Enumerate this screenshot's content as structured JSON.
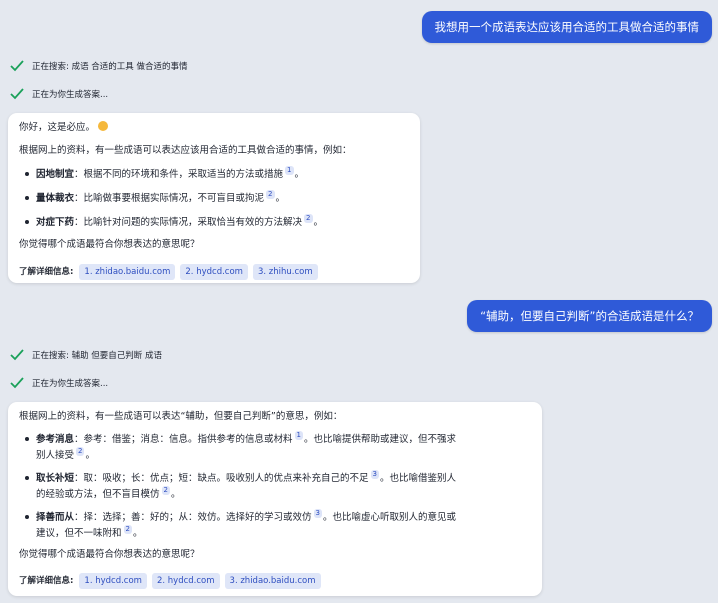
{
  "conversation": {
    "turn1": {
      "user_message": "我想用一个成语表达应该用合适的工具做合适的事情",
      "status_search": "正在搜索: 成语 合适的工具 做合适的事情",
      "status_generating": "正在为你生成答案...",
      "greeting": "你好，这是必应。",
      "intro": "根据网上的资料，有一些成语可以表达应该用合适的工具做合适的事情，例如：",
      "items": [
        {
          "term": "因地制宜",
          "sep": "：",
          "desc": "根据不同的环境和条件，采取适当的方法或措施",
          "cite": "1",
          "end": "。"
        },
        {
          "term": "量体裁衣",
          "sep": "：",
          "desc": "比喻做事要根据实际情况，不可盲目或拘泥",
          "cite": "2",
          "end": "。"
        },
        {
          "term": "对症下药",
          "sep": "：",
          "desc": "比喻针对问题的实际情况，采取恰当有效的方法解决",
          "cite": "2",
          "end": "。"
        }
      ],
      "question": "你觉得哪个成语最符合你想表达的意思呢？",
      "learn_more_label": "了解详细信息:",
      "sources": [
        "1. zhidao.baidu.com",
        "2. hydcd.com",
        "3. zhihu.com"
      ]
    },
    "turn2": {
      "user_message": "“辅助，但要自己判断”的合适成语是什么？",
      "status_search": "正在搜索: 辅助 但要自己判断 成语",
      "status_generating": "正在为你生成答案...",
      "intro": "根据网上的资料，有一些成语可以表达“辅助，但要自己判断”的意思，例如：",
      "items": [
        {
          "term": "参考消息",
          "line1": "：参考：借鉴；消息：信息。指供参考的信息或材料",
          "cite1": "1",
          "line1b": "。也比喻提供帮助或建议，但不强求",
          "line2": "别人接受",
          "cite2": "2",
          "end": "。"
        },
        {
          "term": "取长补短",
          "line1": "：取：吸收；长：优点；短：缺点。吸收别人的优点来补充自己的不足",
          "cite1": "3",
          "line1b": "。也比喻借鉴别人",
          "line2": "的经验或方法，但不盲目模仿",
          "cite2": "2",
          "end": "。"
        },
        {
          "term": "择善而从",
          "line1": "：择：选择；善：好的；从：效仿。选择好的学习或效仿",
          "cite1": "3",
          "line1b": "。也比喻虚心听取别人的意见或",
          "line2": "建议，但不一味附和",
          "cite2": "2",
          "end": "。"
        }
      ],
      "question": "你觉得哪个成语最符合你想表达的意思呢？",
      "learn_more_label": "了解详细信息:",
      "sources": [
        "1. hydcd.com",
        "2. hydcd.com",
        "3. zhidao.baidu.com"
      ]
    }
  },
  "colors": {
    "user_bubble": "#2f5ad8",
    "check": "#1aa15a",
    "citation": "#2f4fc0",
    "background": "#e4e8ef"
  },
  "icons": [
    "check-icon",
    "smile-emoji-icon"
  ]
}
